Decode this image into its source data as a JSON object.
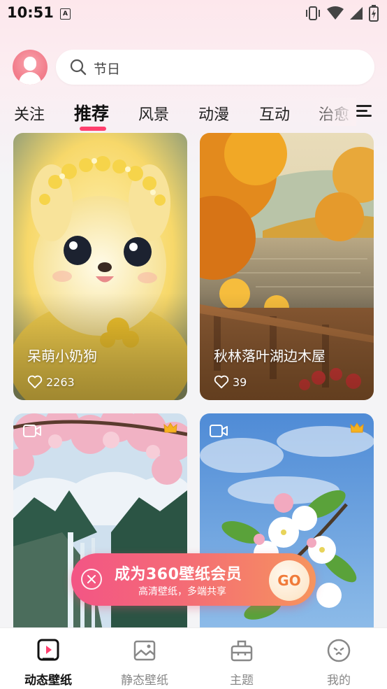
{
  "status_bar": {
    "time": "10:51",
    "notification_letter": "A"
  },
  "search": {
    "placeholder": "节日"
  },
  "tabs": [
    {
      "label": "关注",
      "active": false
    },
    {
      "label": "推荐",
      "active": true
    },
    {
      "label": "风景",
      "active": false
    },
    {
      "label": "动漫",
      "active": false
    },
    {
      "label": "互动",
      "active": false
    },
    {
      "label": "治愈",
      "active": false
    }
  ],
  "cards": [
    {
      "title": "呆萌小奶狗",
      "likes": "2263",
      "theme": "yellow-puppy"
    },
    {
      "title": "秋林落叶湖边木屋",
      "likes": "39",
      "theme": "autumn-lake"
    },
    {
      "title": "",
      "likes": "",
      "theme": "waterfall-cherry",
      "video": true,
      "vip": true
    },
    {
      "title": "",
      "likes": "",
      "theme": "white-blossom",
      "video": true,
      "vip": true
    }
  ],
  "promo": {
    "title": "成为360壁纸会员",
    "subtitle": "高清壁纸，多端共享",
    "go_label": "GO"
  },
  "bottom_nav": [
    {
      "label": "动态壁纸",
      "icon": "dynamic-wallpaper-icon",
      "active": true
    },
    {
      "label": "静态壁纸",
      "icon": "image-icon",
      "active": false
    },
    {
      "label": "主题",
      "icon": "theme-icon",
      "active": false
    },
    {
      "label": "我的",
      "icon": "profile-face-icon",
      "active": false
    }
  ],
  "colors": {
    "accent": "#ff3f6e",
    "promo_start": "#f35585",
    "promo_end": "#f6945d"
  }
}
